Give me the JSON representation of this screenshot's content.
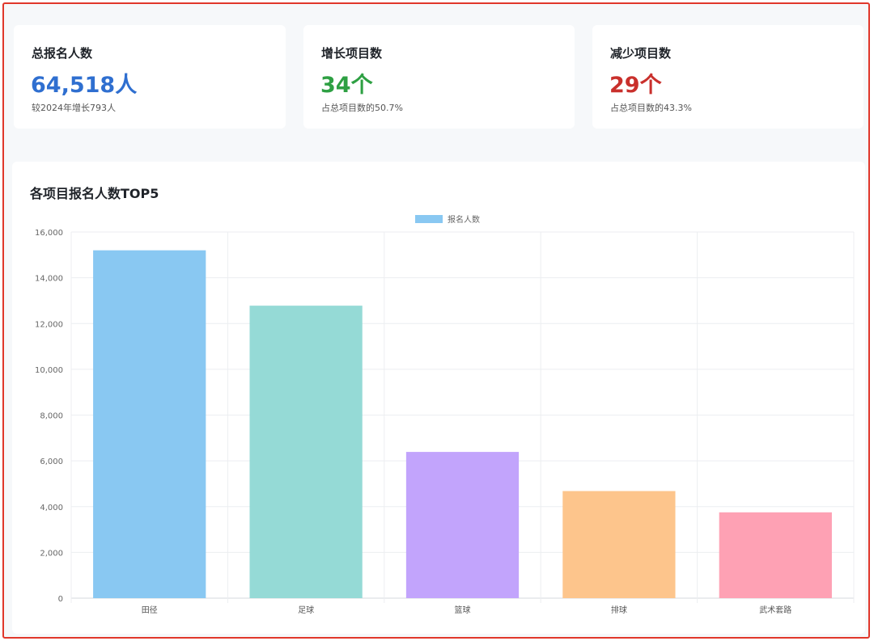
{
  "stats": [
    {
      "title": "总报名人数",
      "value": "64,518人",
      "note": "较2024年增长793人",
      "color": "#2f6fd0"
    },
    {
      "title": "增长项目数",
      "value": "34个",
      "note": "占总项目数的50.7%",
      "color": "#2ea043"
    },
    {
      "title": "减少项目数",
      "value": "29个",
      "note": "占总项目数的43.3%",
      "color": "#c9302c"
    }
  ],
  "chart_title": "各项目报名人数TOP5",
  "chart_data": {
    "type": "bar",
    "title": "各项目报名人数TOP5",
    "categories": [
      "田径",
      "足球",
      "篮球",
      "排球",
      "武术套路"
    ],
    "series": [
      {
        "name": "报名人数",
        "values": [
          15200,
          12780,
          6390,
          4680,
          3750
        ]
      }
    ],
    "bar_colors": [
      "#89c8f2",
      "#95dad6",
      "#c2a4fc",
      "#fdc58c",
      "#fea1b4"
    ],
    "legend_color": "#89c8f2",
    "ylim": [
      0,
      16000
    ],
    "y_ticks": [
      "0",
      "2,000",
      "4,000",
      "6,000",
      "8,000",
      "10,000",
      "12,000",
      "14,000",
      "16,000"
    ],
    "grid": true,
    "legend_position": "top-center",
    "xlabel": "",
    "ylabel": ""
  }
}
